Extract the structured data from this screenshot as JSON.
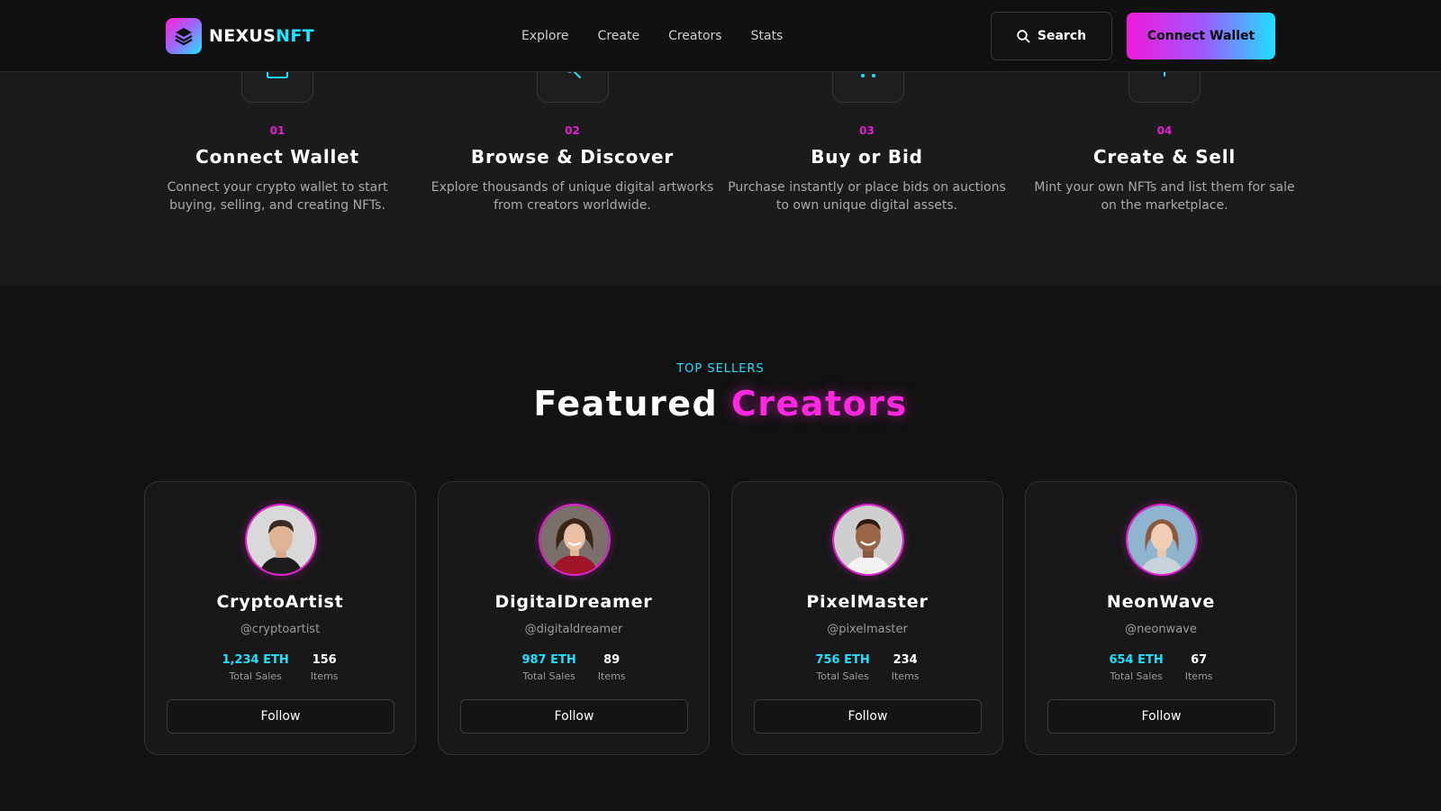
{
  "brand": {
    "name_main": "NEXUS",
    "name_accent": "NFT",
    "colors": {
      "magenta": "#ff28e0",
      "cyan": "#1fe0ff",
      "background": "#121212"
    }
  },
  "nav": {
    "links": [
      "Explore",
      "Create",
      "Creators",
      "Stats"
    ],
    "search_label": "Search",
    "connect_label": "Connect Wallet"
  },
  "steps": [
    {
      "number": "01",
      "title": "Connect Wallet",
      "desc": "Connect your crypto wallet to start buying, selling, and creating NFTs.",
      "icon": "wallet-icon"
    },
    {
      "number": "02",
      "title": "Browse & Discover",
      "desc": "Explore thousands of unique digital artworks from creators worldwide.",
      "icon": "search-icon"
    },
    {
      "number": "03",
      "title": "Buy or Bid",
      "desc": "Purchase instantly or place bids on auctions to own unique digital assets.",
      "icon": "cart-icon"
    },
    {
      "number": "04",
      "title": "Create & Sell",
      "desc": "Mint your own NFTs and list them for sale on the marketplace.",
      "icon": "plus-icon"
    }
  ],
  "creators_section": {
    "eyebrow": "TOP SELLERS",
    "title_main": "Featured",
    "title_accent": "Creators"
  },
  "creators": [
    {
      "name": "CryptoArtist",
      "handle": "@cryptoartist",
      "total_sales": "1,234 ETH",
      "total_sales_label": "Total Sales",
      "items": "156",
      "items_label": "Items",
      "follow_label": "Follow"
    },
    {
      "name": "DigitalDreamer",
      "handle": "@digitaldreamer",
      "total_sales": "987 ETH",
      "total_sales_label": "Total Sales",
      "items": "89",
      "items_label": "Items",
      "follow_label": "Follow"
    },
    {
      "name": "PixelMaster",
      "handle": "@pixelmaster",
      "total_sales": "756 ETH",
      "total_sales_label": "Total Sales",
      "items": "234",
      "items_label": "Items",
      "follow_label": "Follow"
    },
    {
      "name": "NeonWave",
      "handle": "@neonwave",
      "total_sales": "654 ETH",
      "total_sales_label": "Total Sales",
      "items": "67",
      "items_label": "Items",
      "follow_label": "Follow"
    }
  ]
}
